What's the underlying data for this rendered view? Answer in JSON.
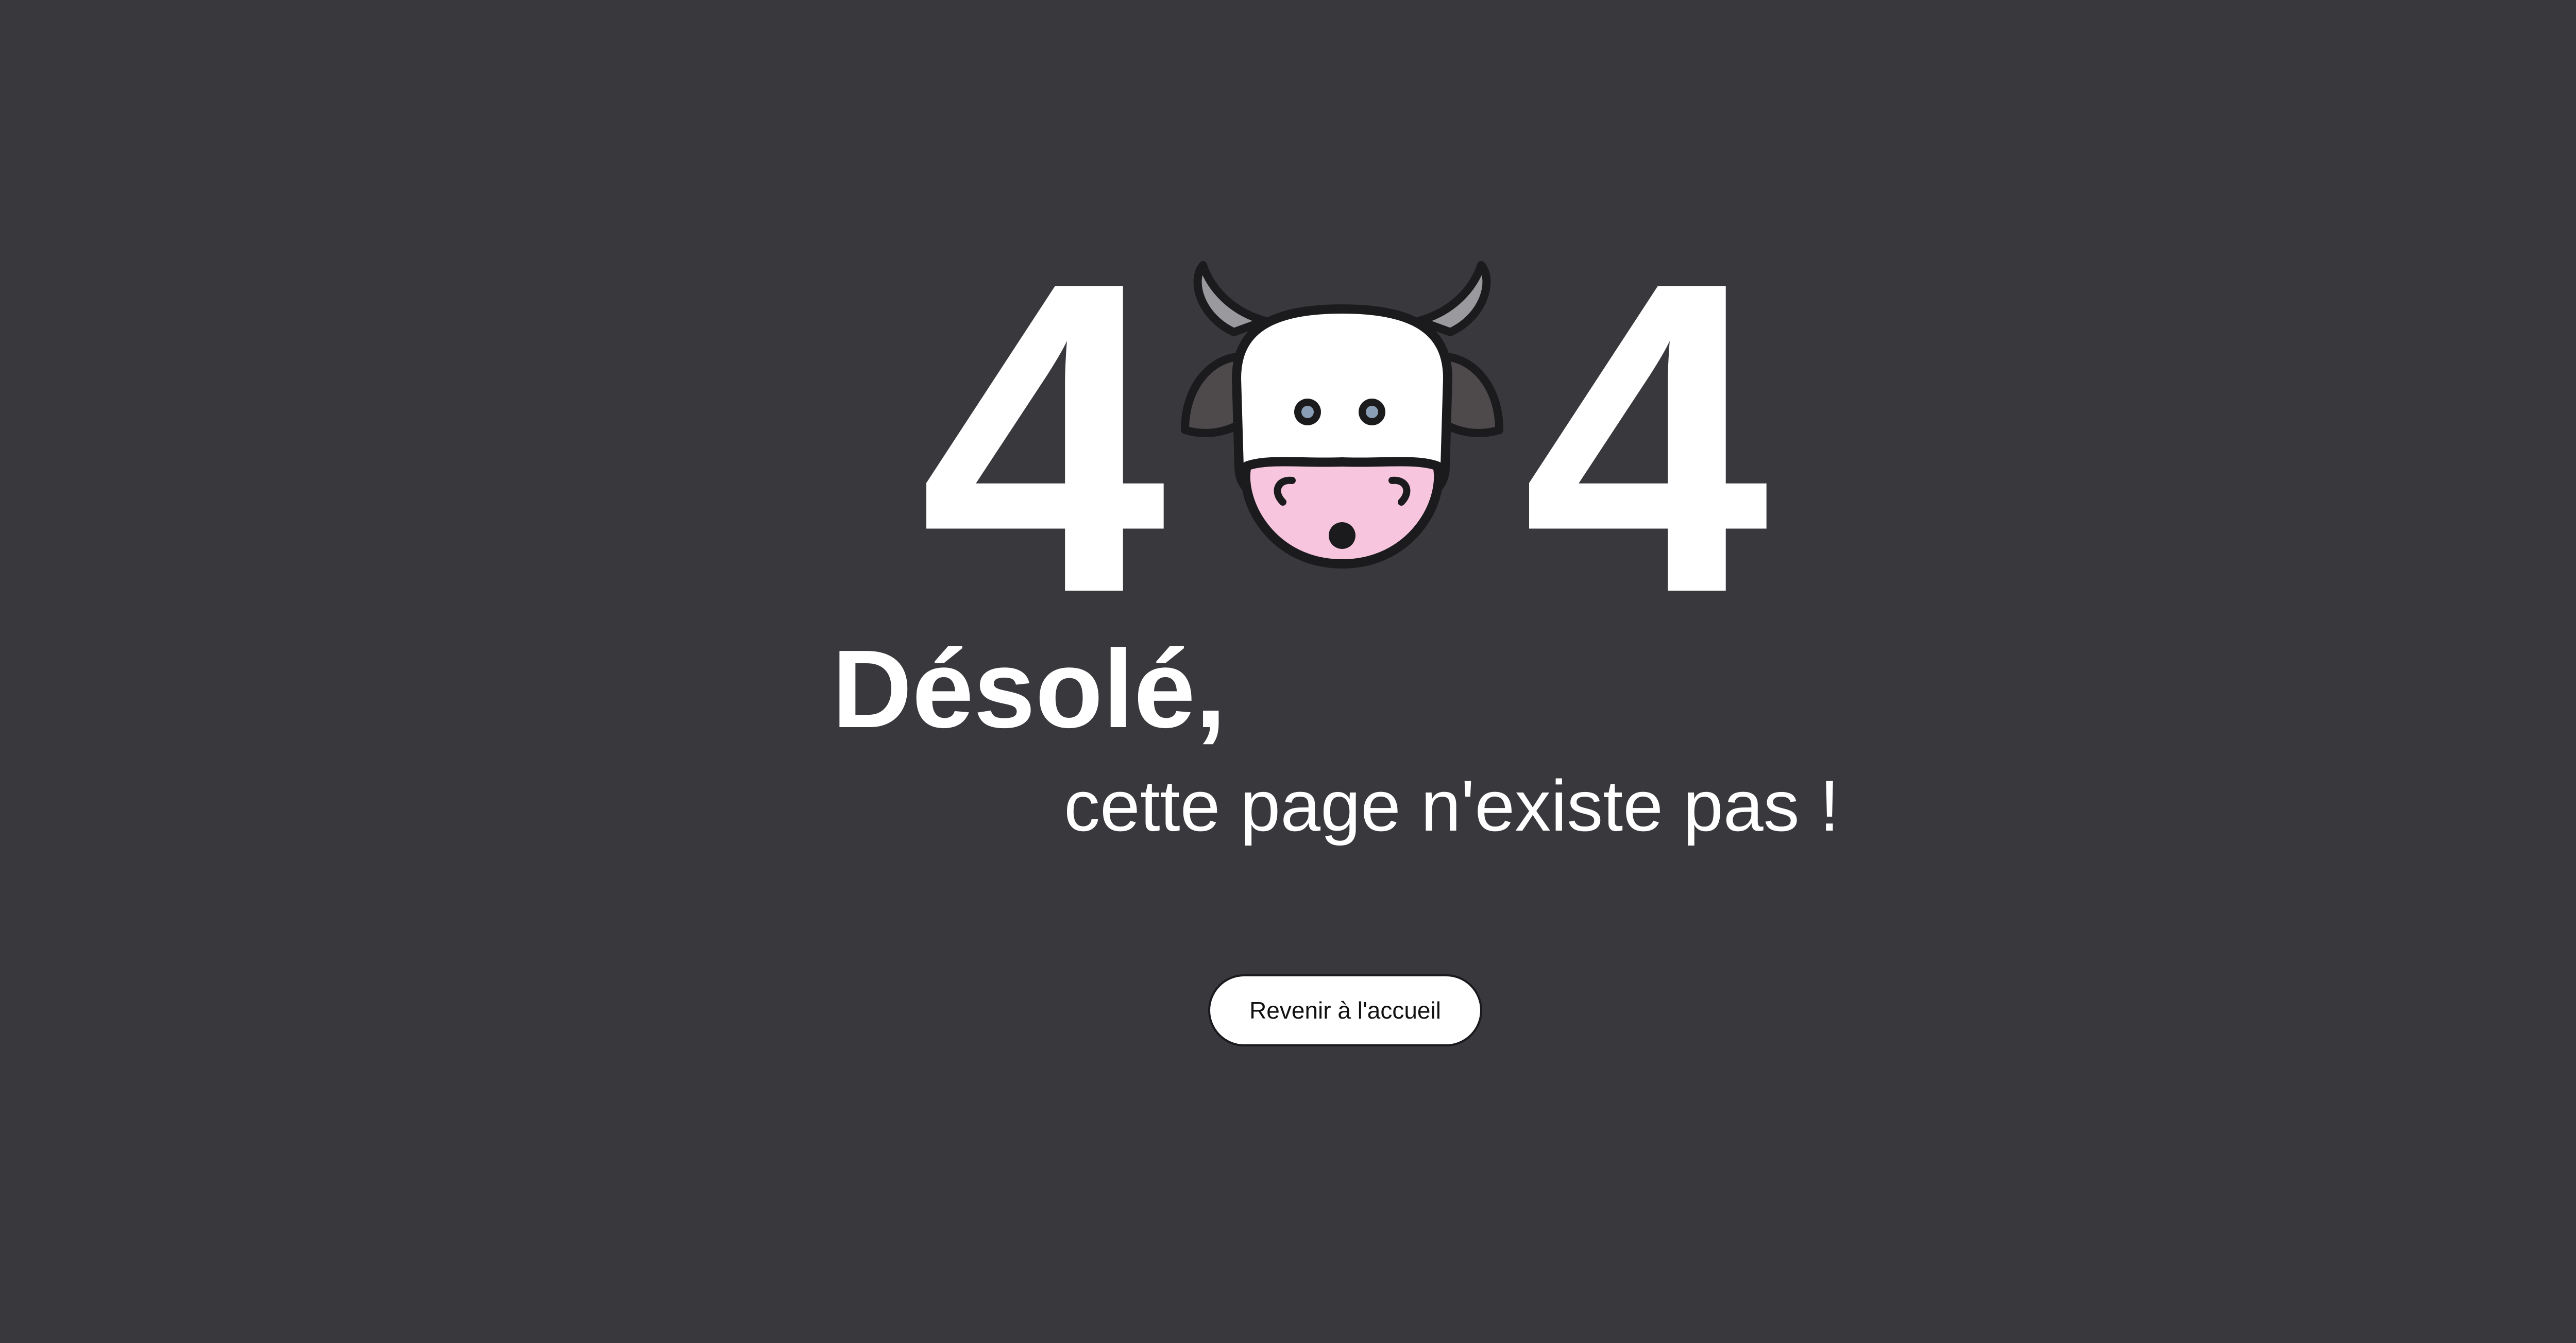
{
  "error": {
    "digit_left": "4",
    "digit_right": "4",
    "middle_image": "cow-face-icon"
  },
  "message": {
    "heading": "Désolé,",
    "subheading": "cette page n'existe pas !"
  },
  "actions": {
    "home_button_label": "Revenir à l'accueil"
  },
  "colors": {
    "background": "#38383d",
    "text": "#ffffff",
    "button_background": "#ffffff",
    "cow_nose": "#f7c6de"
  }
}
